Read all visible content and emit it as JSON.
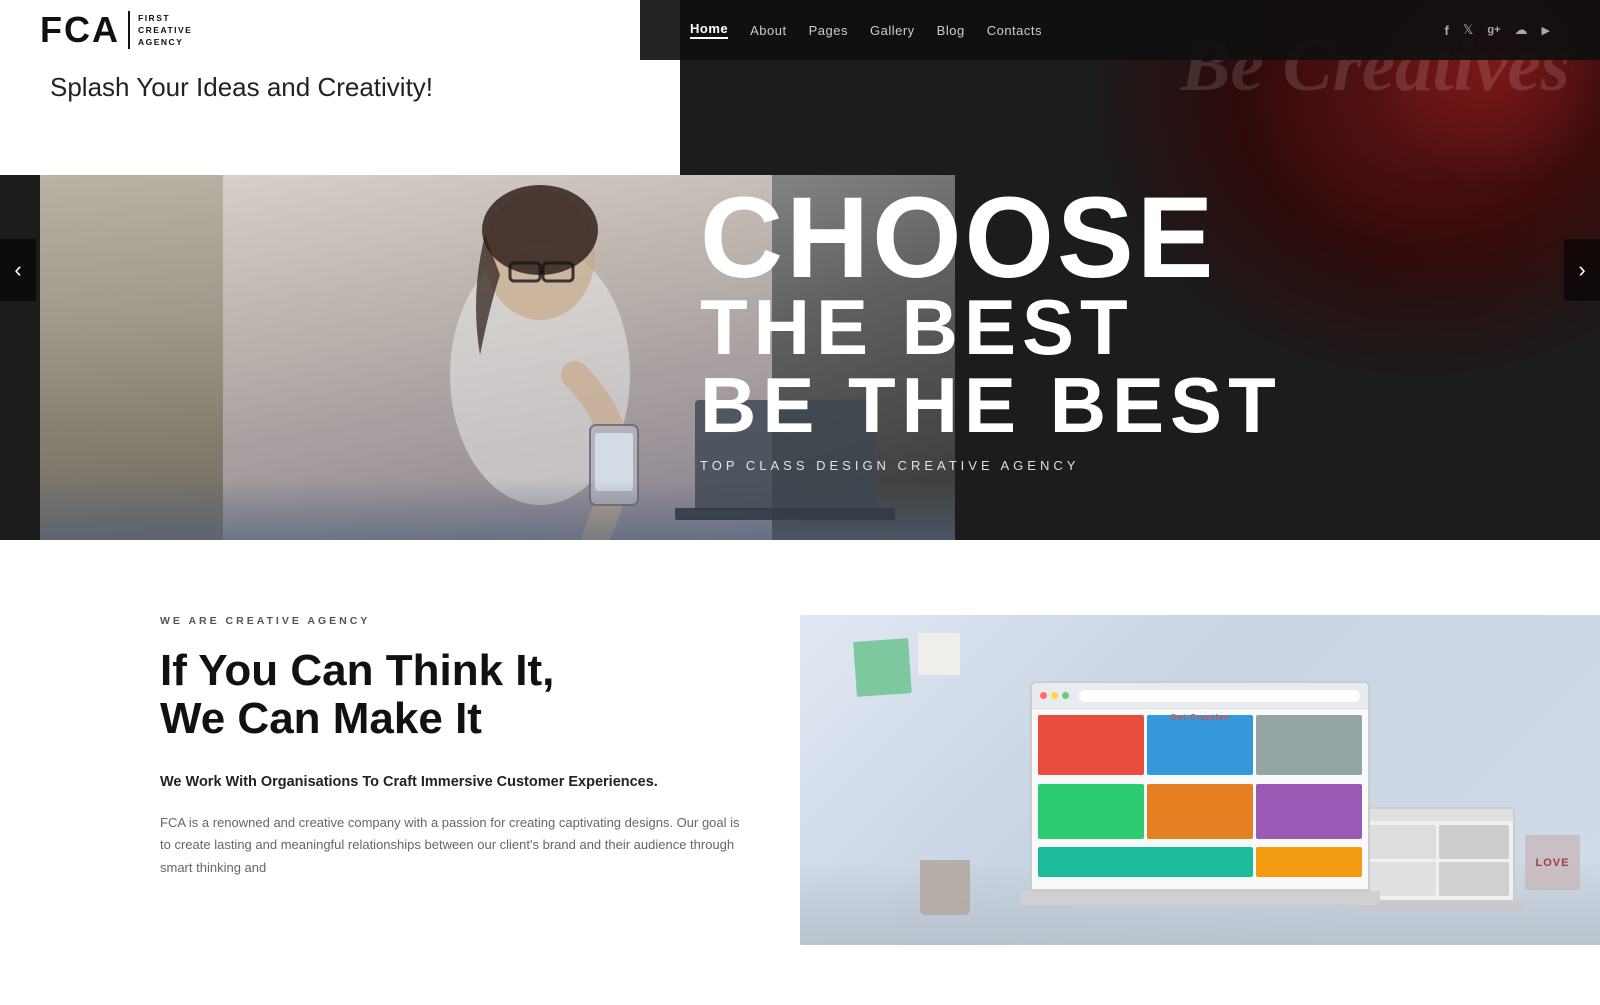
{
  "brand": {
    "logo_text": "FCA|",
    "logo_fca": "FCA",
    "logo_subtitle_line1": "FIRST",
    "logo_subtitle_line2": "CREATIVE",
    "logo_subtitle_line3": "AGENCY"
  },
  "nav": {
    "items": [
      {
        "label": "Home",
        "active": true
      },
      {
        "label": "About",
        "active": false
      },
      {
        "label": "Pages",
        "active": false
      },
      {
        "label": "Gallery",
        "active": false
      },
      {
        "label": "Blog",
        "active": false
      },
      {
        "label": "Contacts",
        "active": false
      }
    ]
  },
  "social": {
    "items": [
      {
        "name": "facebook-icon",
        "symbol": "f"
      },
      {
        "name": "twitter-icon",
        "symbol": "t"
      },
      {
        "name": "googleplus-icon",
        "symbol": "g+"
      },
      {
        "name": "skype-icon",
        "symbol": "s"
      },
      {
        "name": "youtube-icon",
        "symbol": "▶"
      }
    ]
  },
  "hero": {
    "tagline": "Splash Your Ideas and Creativity!",
    "headline_line1": "CHOOSE",
    "headline_line2": "THE BEST",
    "headline_line3": "BE THE BEST",
    "subtitle": "TOP CLASS DESIGN CREATIVE AGENCY",
    "decorative_text": "Be Creatives"
  },
  "carousel": {
    "prev_label": "‹",
    "next_label": "›"
  },
  "content": {
    "label": "WE ARE CREATIVE AGENCY",
    "heading_line1": "If You Can Think It,",
    "heading_line2": "We Can Make It",
    "subheading": "We Work With Organisations To Craft Immersive Customer Experiences.",
    "body": "FCA is a renowned and creative company with a passion for creating captivating designs. Our goal is to create lasting and meaningful relationships between our client's brand and their audience through smart thinking and"
  }
}
